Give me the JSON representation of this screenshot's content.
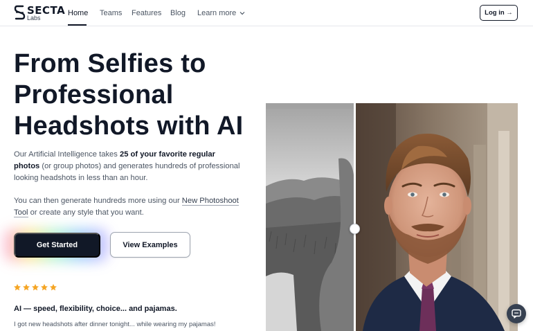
{
  "brand": {
    "name": "SECTA",
    "sub": "Labs"
  },
  "nav": {
    "links": [
      {
        "label": "Home"
      },
      {
        "label": "Teams"
      },
      {
        "label": "Features"
      },
      {
        "label": "Blog"
      },
      {
        "label": "Learn more"
      }
    ],
    "active": "Home",
    "login_label": "Log in →"
  },
  "hero": {
    "headline": "From Selfies to Professional Headshots with AI",
    "p1_a": "Our Artificial Intelligence takes ",
    "p1_bold": "25 of your favorite regular photos",
    "p1_b": " (or group photos) and generates hundreds of professional looking headshots in less than an hour.",
    "p2_a": "You can then generate hundreds more using our ",
    "p2_link": "New Photoshoot Tool",
    "p2_b": " or create any style that you want.",
    "primary_cta": "Get Started",
    "secondary_cta": "View Examples"
  },
  "testimonial": {
    "rating": 5,
    "title": "AI — speed, flexibility, choice... and pajamas.",
    "text": "I got new headshots after dinner tonight... while wearing my pajamas!"
  },
  "compare": {
    "before_label": "selfie (grayscale)",
    "after_label": "professional headshot"
  },
  "colors": {
    "primary": "#111827",
    "star": "#f5a524",
    "text_muted": "#4b5563",
    "border": "#e5e7eb"
  },
  "icons": {
    "logo": "s-mark-icon",
    "chevron": "chevron-down-icon",
    "star": "star-icon",
    "chat": "chat-bubble-icon"
  }
}
